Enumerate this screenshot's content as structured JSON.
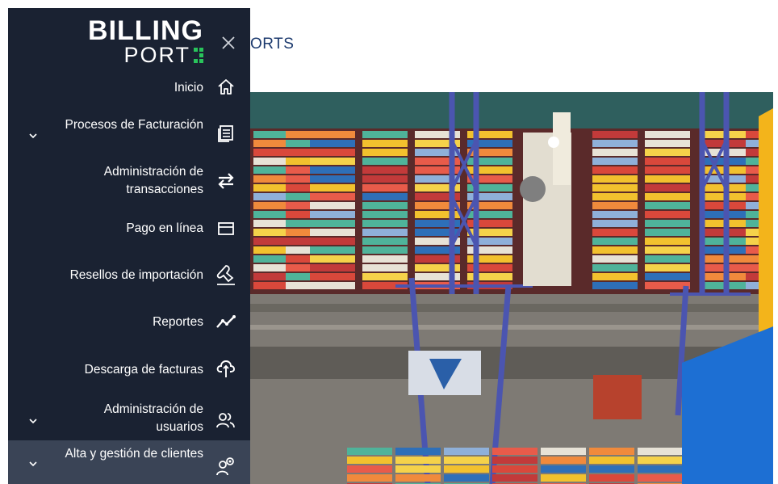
{
  "page": {
    "heading": "ORTS"
  },
  "brand": {
    "line1": "BILLING",
    "line2": "PORT"
  },
  "drawer": {
    "close_icon": "close-icon",
    "items": [
      {
        "label": "Inicio",
        "icon": "home-icon",
        "expandable": false
      },
      {
        "label": "Procesos de Facturación",
        "icon": "invoice-icon",
        "expandable": true
      },
      {
        "label_line1": "Administración de",
        "label_line2": "transacciones",
        "icon": "transfer-icon",
        "expandable": false
      },
      {
        "label": "Pago en línea",
        "icon": "card-icon",
        "expandable": false
      },
      {
        "label": "Resellos de importación",
        "icon": "stamp-icon",
        "expandable": false
      },
      {
        "label": "Reportes",
        "icon": "chart-line-icon",
        "expandable": false
      },
      {
        "label": "Descarga de facturas",
        "icon": "cloud-download-icon",
        "expandable": false
      },
      {
        "label_line1": "Administración de",
        "label_line2": "usuarios",
        "icon": "users-icon",
        "expandable": true
      },
      {
        "label": "Alta y gestión de clientes",
        "icon": "client-search-icon",
        "expandable": true,
        "active": true
      }
    ]
  },
  "colors": {
    "drawer_bg": "#1a2232",
    "active_bg": "#3a4456",
    "brand_accent": "#29c45b",
    "heading": "#1c3a6e"
  }
}
